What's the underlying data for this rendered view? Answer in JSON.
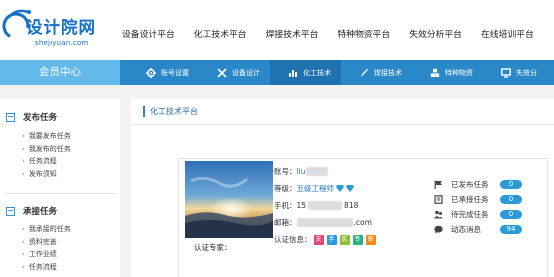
{
  "logo": {
    "name": "设计院网",
    "domain": "shejiyuan.com"
  },
  "top_nav": [
    "设备设计平台",
    "化工技术平台",
    "焊接技术平台",
    "特种物资平台",
    "失效分析平台",
    "在线培训平台"
  ],
  "member_center": "会员中心",
  "sub_nav": [
    {
      "label": "账号设置",
      "icon": "gear-icon",
      "active": false
    },
    {
      "label": "设备设计",
      "icon": "tools-icon",
      "active": false
    },
    {
      "label": "化工技术",
      "icon": "bar-chart-icon",
      "active": true
    },
    {
      "label": "焊接技术",
      "icon": "pen-icon",
      "active": false
    },
    {
      "label": "特种物资",
      "icon": "cubes-icon",
      "active": false
    },
    {
      "label": "失效分",
      "icon": "monitor-icon",
      "active": false
    }
  ],
  "sidebar": {
    "sections": [
      {
        "title": "发布任务",
        "items": [
          "我要发布任务",
          "我发布的任务",
          "任务流程",
          "发布须知"
        ]
      },
      {
        "title": "承接任务",
        "items": [
          "我承接的任务",
          "资料完善",
          "工作业绩",
          "任务流程"
        ]
      }
    ]
  },
  "panel": {
    "title": "化工技术平台"
  },
  "profile": {
    "account_label": "账号：",
    "account_value": "liu",
    "level_label": "等级：",
    "level_value": "五级工程师",
    "phone_label": "手机：",
    "phone_prefix": "15",
    "phone_suffix": "818",
    "email_label": "邮箱：",
    "email_suffix": ".com",
    "cert_label": "认证信息：",
    "cert_tags": [
      {
        "text": "支",
        "color": "#e2457a"
      },
      {
        "text": "手",
        "color": "#2b9ad9"
      },
      {
        "text": "实",
        "color": "#8bbf3b"
      },
      {
        "text": "专",
        "color": "#2eaf8a"
      },
      {
        "text": "邮",
        "color": "#f28a1b"
      }
    ],
    "expert_label": "认证专家："
  },
  "stats": [
    {
      "label": "已发布任务",
      "value": "0",
      "icon": "flag-icon"
    },
    {
      "label": "已承接任务",
      "value": "0",
      "icon": "bookmark-icon"
    },
    {
      "label": "待完成任务",
      "value": "0",
      "icon": "people-icon"
    },
    {
      "label": "动态消息",
      "value": "94",
      "icon": "chat-icon"
    }
  ],
  "colors": {
    "accent_blue": "#2b88c8",
    "member_bg": "#63b9e9",
    "active_tab": "#1f72b0",
    "pill": "#2b9ad9",
    "logo": "#1570c4"
  }
}
